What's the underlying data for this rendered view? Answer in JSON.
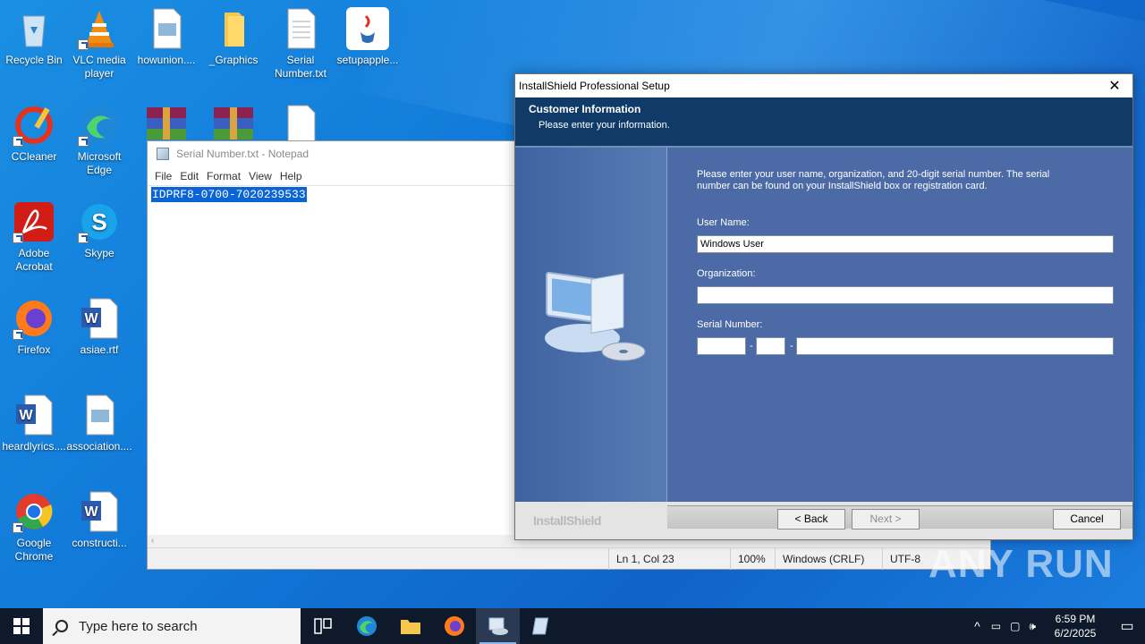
{
  "desktop": {
    "icons": [
      {
        "label": "Recycle Bin",
        "icon": "recycle-bin-icon"
      },
      {
        "label": "VLC media player",
        "icon": "vlc-icon"
      },
      {
        "label": "howunion....",
        "icon": "image-file-icon"
      },
      {
        "label": "_Graphics",
        "icon": "folder-icon"
      },
      {
        "label": "Serial Number.txt",
        "icon": "text-file-icon"
      },
      {
        "label": "setupapple...",
        "icon": "java-icon"
      },
      {
        "label": "CCleaner",
        "icon": "ccleaner-icon"
      },
      {
        "label": "Microsoft Edge",
        "icon": "edge-icon"
      },
      {
        "label": "Adobe Acrobat",
        "icon": "acrobat-icon"
      },
      {
        "label": "Skype",
        "icon": "skype-icon"
      },
      {
        "label": "Firefox",
        "icon": "firefox-icon"
      },
      {
        "label": "asiae.rtf",
        "icon": "word-doc-icon"
      },
      {
        "label": "heardlyrics....",
        "icon": "word-doc-icon"
      },
      {
        "label": "association....",
        "icon": "image-file-icon"
      },
      {
        "label": "Google Chrome",
        "icon": "chrome-icon"
      },
      {
        "label": "constructi...",
        "icon": "word-doc-icon"
      }
    ]
  },
  "notepad": {
    "title": "Serial Number.txt - Notepad",
    "menu": [
      "File",
      "Edit",
      "Format",
      "View",
      "Help"
    ],
    "content": "IDPRF8-0700-7020239533",
    "status": {
      "position": "Ln 1, Col 23",
      "zoom": "100%",
      "line_ending": "Windows (CRLF)",
      "encoding": "UTF-8"
    }
  },
  "installer": {
    "title": "InstallShield Professional Setup",
    "header_title": "Customer Information",
    "header_subtitle": "Please enter your information.",
    "intro": "Please enter your user name, organization, and 20-digit serial number. The serial number can be found on your InstallShield box or registration card.",
    "user_name_label": "User Name:",
    "user_name_value": "Windows User",
    "organization_label": "Organization:",
    "organization_value": "",
    "serial_label": "Serial Number:",
    "serial_separator": "-",
    "brand": "InstallShield",
    "back_label": "< Back",
    "next_label": "Next >",
    "cancel_label": "Cancel"
  },
  "watermark": "ANY RUN",
  "taskbar": {
    "search_placeholder": "Type here to search",
    "time": "6:59 PM",
    "date": "6/2/2025"
  }
}
